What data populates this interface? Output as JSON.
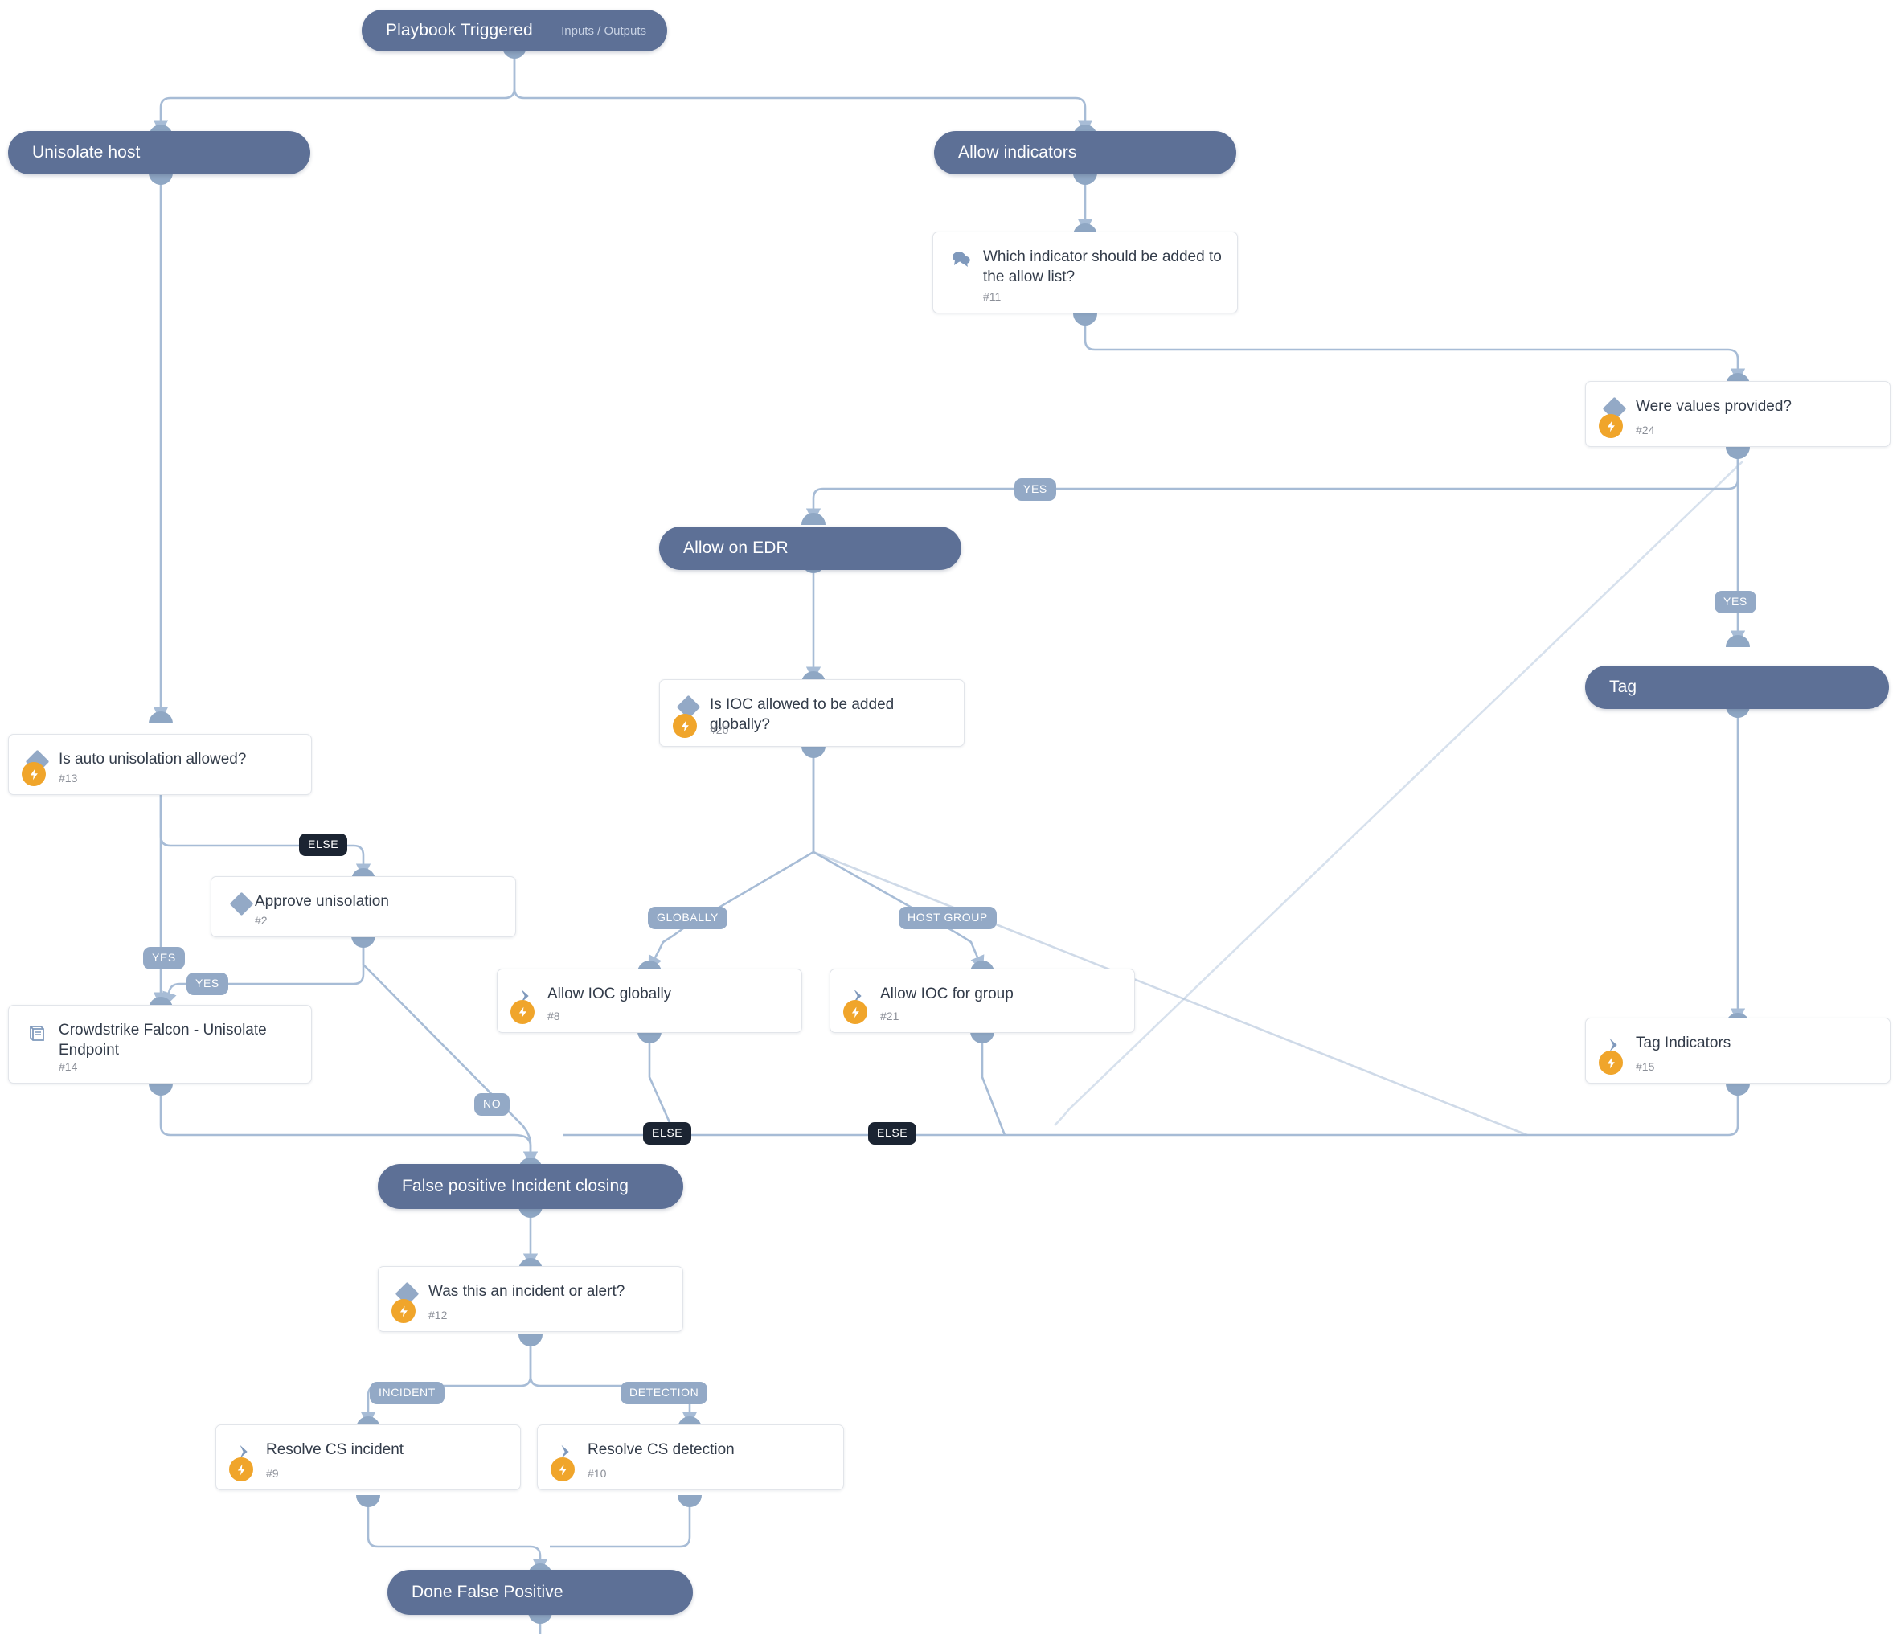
{
  "diagram": {
    "type": "playbook-workflow",
    "title": "Playbook Triggered",
    "colors": {
      "section_node": "#5d7096",
      "card_bg": "#ffffff",
      "edge": "#a7bcd6",
      "branch_label": "#93a9c6",
      "branch_label_else": "#1b2432",
      "automation_badge": "#f0a52b"
    }
  },
  "nodes": {
    "start": {
      "label": "Playbook Triggered",
      "sub": "Inputs / Outputs"
    },
    "unisolate_host": {
      "label": "Unisolate host"
    },
    "allow_indicators": {
      "label": "Allow indicators"
    },
    "which_indicator": {
      "label": "Which indicator should be added to the allow list?",
      "num": "#11",
      "icon": "chat-icon"
    },
    "were_values": {
      "label": "Were values provided?",
      "num": "#24",
      "icon": "diamond-icon"
    },
    "allow_on_edr": {
      "label": "Allow on EDR"
    },
    "ioc_global": {
      "label": "Is IOC allowed to be added globally?",
      "num": "#20",
      "icon": "diamond-icon"
    },
    "auto_unisolation": {
      "label": "Is auto unisolation allowed?",
      "num": "#13",
      "icon": "diamond-icon"
    },
    "approve_unisolation": {
      "label": "Approve unisolation",
      "num": "#2",
      "icon": "diamond-icon"
    },
    "tag": {
      "label": "Tag"
    },
    "crowdstrike_unisolate": {
      "label": "Crowdstrike Falcon - Unisolate Endpoint",
      "num": "#14",
      "icon": "book-icon"
    },
    "allow_ioc_globally": {
      "label": "Allow IOC globally",
      "num": "#8",
      "icon": "chevron-icon"
    },
    "allow_ioc_group": {
      "label": "Allow IOC for group",
      "num": "#21",
      "icon": "chevron-icon"
    },
    "tag_indicators": {
      "label": "Tag Indicators",
      "num": "#15",
      "icon": "chevron-icon"
    },
    "false_positive_closing": {
      "label": "False positive Incident closing"
    },
    "incident_or_alert": {
      "label": "Was this an incident or alert?",
      "num": "#12",
      "icon": "diamond-icon"
    },
    "resolve_cs_incident": {
      "label": "Resolve CS incident",
      "num": "#9",
      "icon": "chevron-icon"
    },
    "resolve_cs_detection": {
      "label": "Resolve CS detection",
      "num": "#10",
      "icon": "chevron-icon"
    },
    "done_false_positive": {
      "label": "Done False Positive"
    }
  },
  "branch_labels": {
    "yes_values_provided": "YES",
    "yes_tag": "YES",
    "yes_auto_unisolation": "YES",
    "yes_approve": "YES",
    "no_approve": "NO",
    "else_auto_unisolation": "ELSE",
    "globally": "GLOBALLY",
    "host_group": "HOST GROUP",
    "else_globally": "ELSE",
    "else_host_group": "ELSE",
    "incident": "INCIDENT",
    "detection": "DETECTION"
  }
}
